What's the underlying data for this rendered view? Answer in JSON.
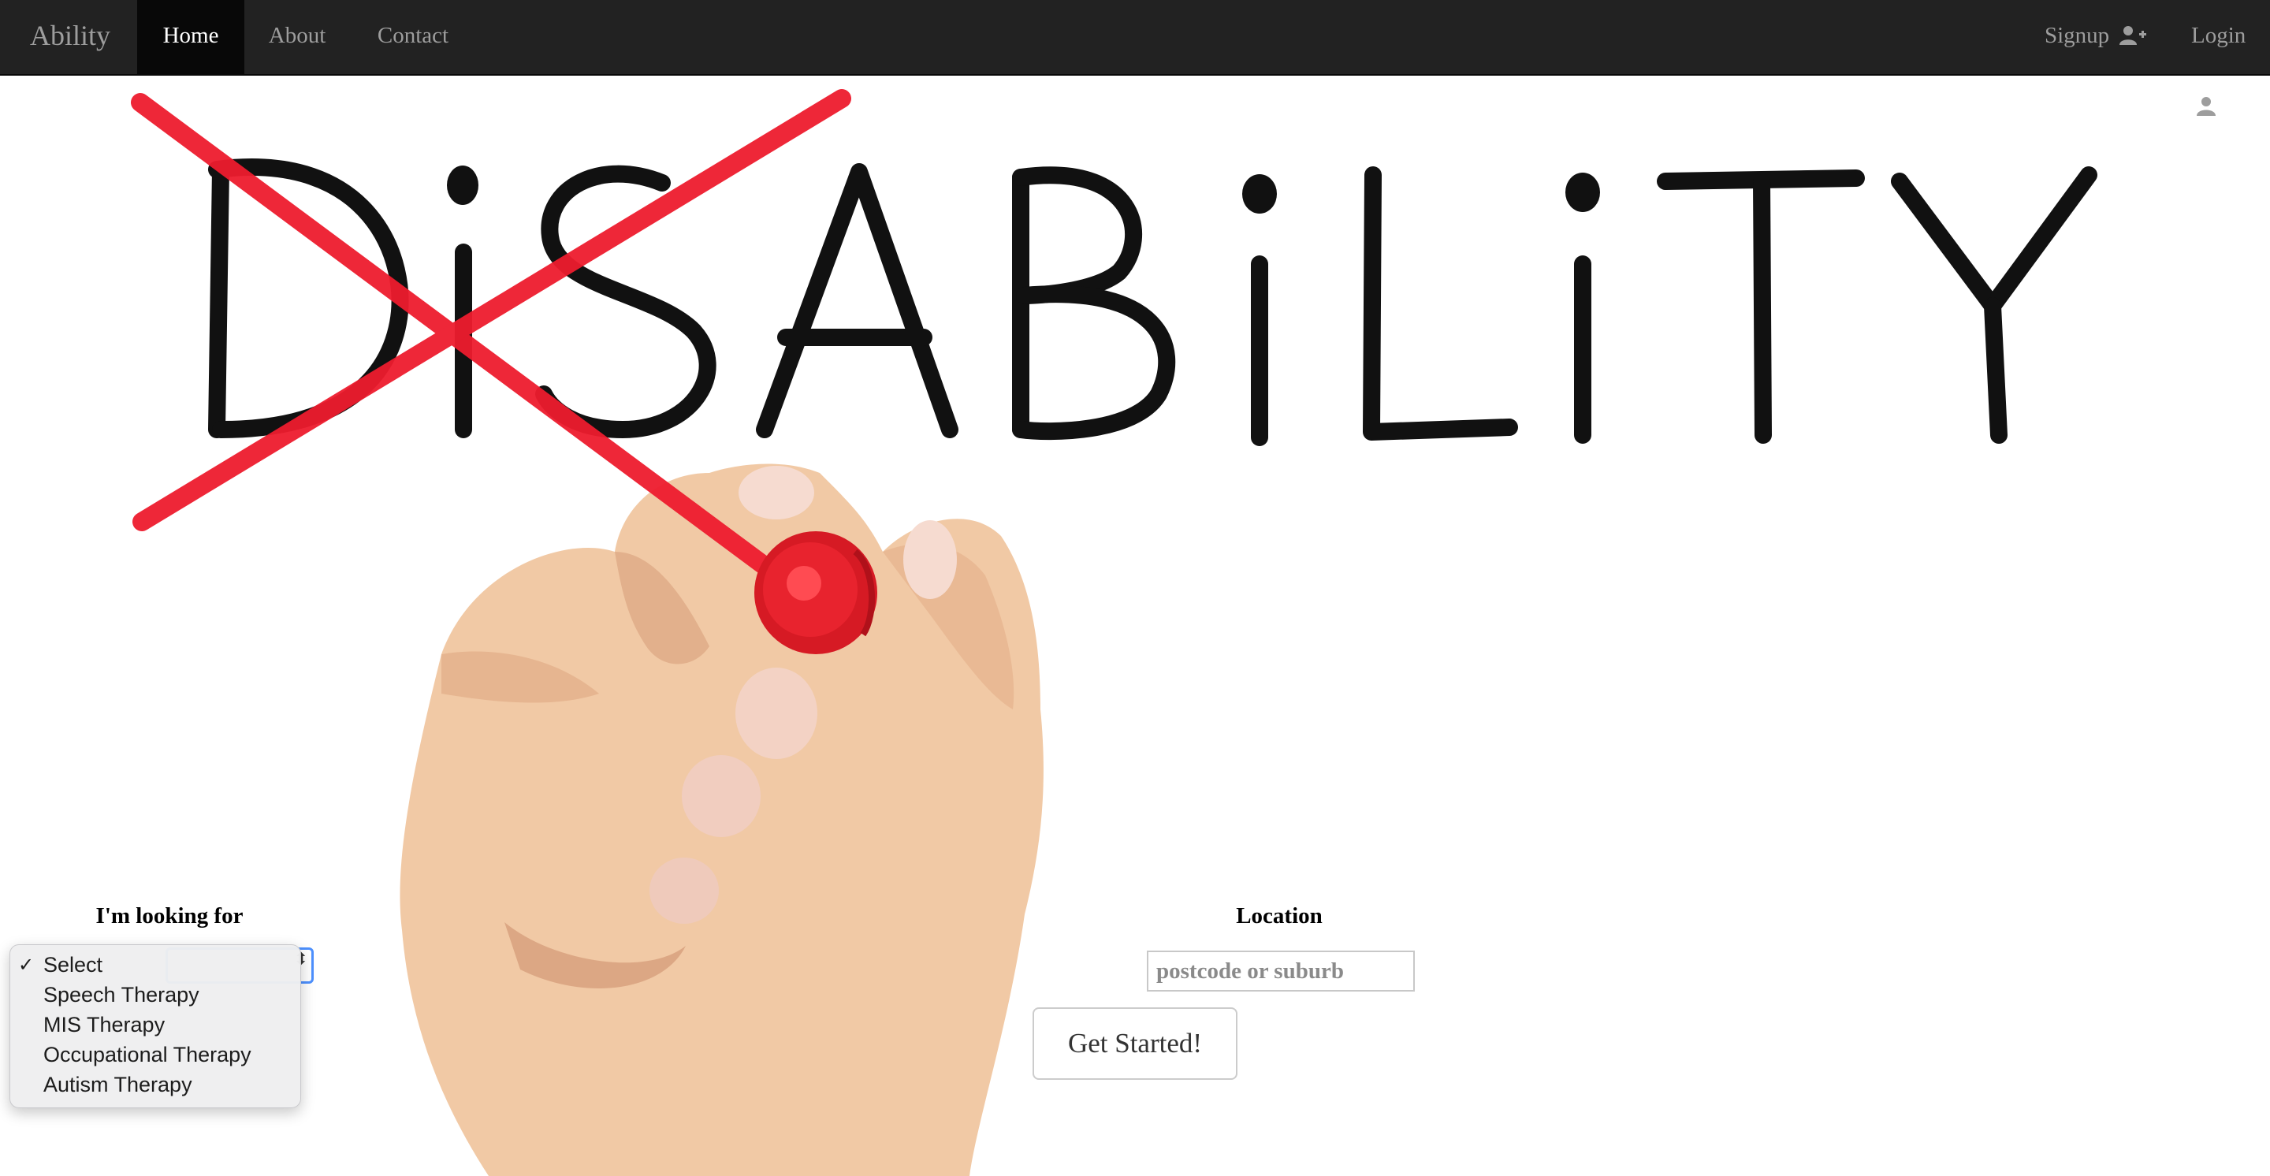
{
  "navbar": {
    "brand": "Ability",
    "links": [
      {
        "label": "Home",
        "active": true
      },
      {
        "label": "About",
        "active": false
      },
      {
        "label": "Contact",
        "active": false
      }
    ],
    "signup_label": "Signup",
    "signup_icon": "user-plus-icon",
    "login_label": "Login",
    "login_icon": "user-icon"
  },
  "hero": {
    "word": "DiSABiLiTY",
    "strike_color": "#ee1c2e",
    "ink_color": "#111111"
  },
  "search": {
    "looking_label": "I'm looking for",
    "service_options": [
      {
        "label": "Select",
        "selected": true
      },
      {
        "label": "Speech Therapy",
        "selected": false
      },
      {
        "label": "MIS Therapy",
        "selected": false
      },
      {
        "label": "Occupational Therapy",
        "selected": false
      },
      {
        "label": "Autism Therapy",
        "selected": false
      }
    ],
    "location_label": "Location",
    "location_placeholder": "postcode or suburb",
    "location_value": "",
    "submit_label": "Get Started!"
  },
  "colors": {
    "navbar_bg": "#222222",
    "navbar_active_bg": "#080808",
    "navbar_text": "#9d9d9d",
    "select_focus": "#4d90fe"
  }
}
